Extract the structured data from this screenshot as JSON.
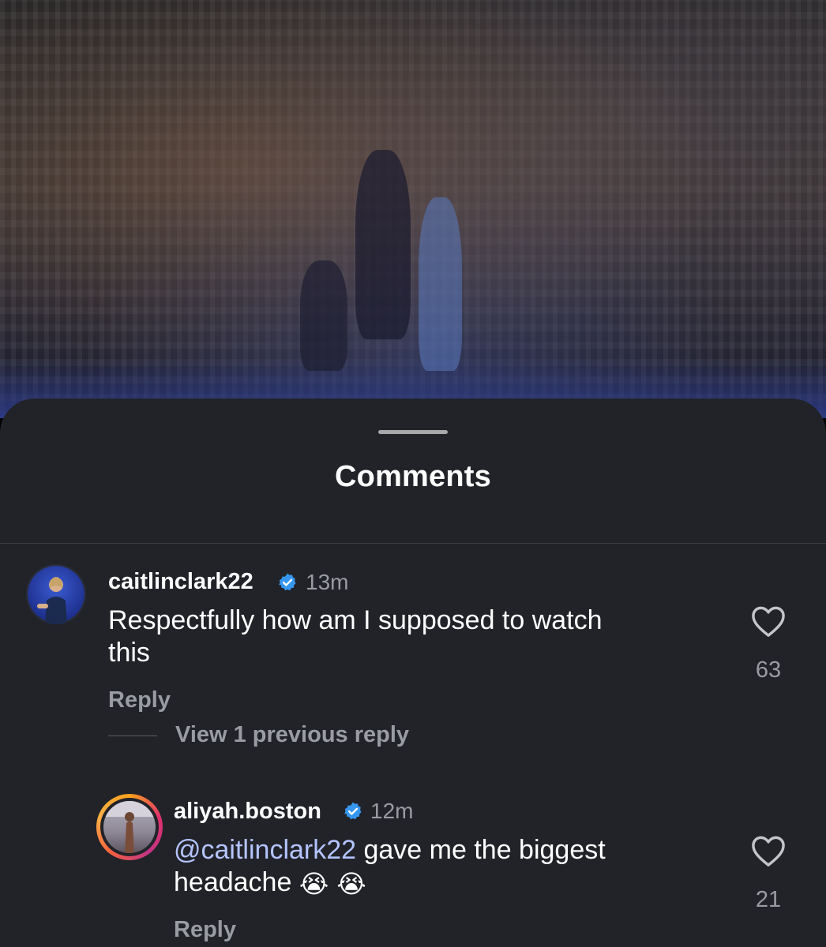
{
  "sheet": {
    "title": "Comments"
  },
  "comments": [
    {
      "username": "caitlinclark22",
      "verified": true,
      "time": "13m",
      "text": "Respectfully how am I supposed to watch this",
      "text_line1": "Respectfully how am I supposed to watch",
      "text_line2": "this",
      "like_count": "63",
      "reply_label": "Reply",
      "view_replies_label": "View 1 previous reply"
    },
    {
      "username": "aliyah.boston",
      "verified": true,
      "time": "12m",
      "mention": "@caitlinclark22",
      "text_line1_rest": " gave me the biggest",
      "text_line2": "headache ",
      "emojis": "😭 😭",
      "like_count": "21",
      "reply_label": "Reply"
    }
  ],
  "colors": {
    "sheet_bg": "#212328",
    "verified_blue": "#3797f0",
    "mention": "#b4c4ff",
    "muted_text": "#9a9ca3"
  },
  "icons": [
    "verified-badge-icon",
    "heart-icon"
  ]
}
